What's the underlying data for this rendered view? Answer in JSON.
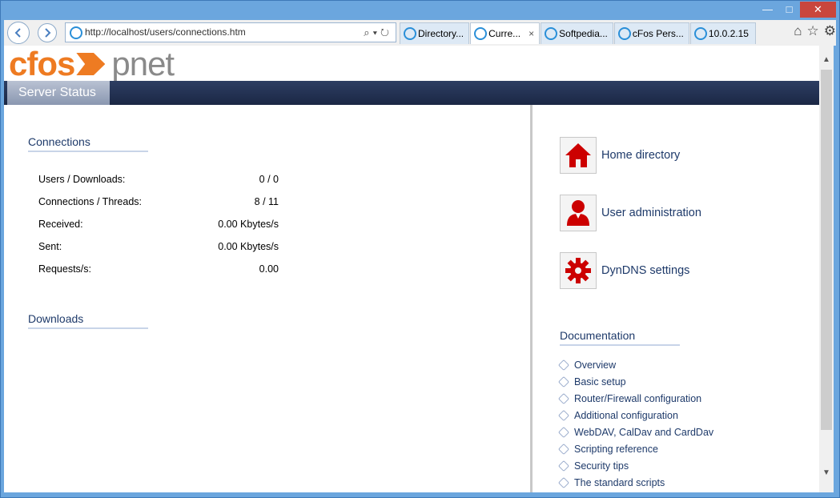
{
  "browser": {
    "url": "http://localhost/users/connections.htm",
    "tabs": [
      {
        "label": "Directory..."
      },
      {
        "label": "Curre...",
        "close": "×"
      },
      {
        "label": "Softpedia..."
      },
      {
        "label": "cFos Pers..."
      },
      {
        "label": "10.0.2.15"
      }
    ]
  },
  "logo": {
    "left": "cfos",
    "right": "pnet"
  },
  "header": {
    "tab": "Server Status"
  },
  "connections": {
    "title": "Connections",
    "rows": [
      {
        "label": "Users / Downloads:",
        "value": "0 / 0"
      },
      {
        "label": "Connections / Threads:",
        "value": "8 / 11"
      },
      {
        "label": "Received:",
        "value": "0.00 Kbytes/s"
      },
      {
        "label": "Sent:",
        "value": "0.00 Kbytes/s"
      },
      {
        "label": "Requests/s:",
        "value": "0.00"
      }
    ]
  },
  "downloads": {
    "title": "Downloads"
  },
  "links": {
    "home": "Home directory",
    "users": "User administration",
    "dyndns": "DynDNS settings"
  },
  "documentation": {
    "title": "Documentation",
    "items": [
      "Overview",
      "Basic setup",
      "Router/Firewall configuration",
      "Additional configuration",
      "WebDAV, CalDav and CardDav",
      "Scripting reference",
      "Security tips",
      "The standard scripts"
    ]
  },
  "colors": {
    "accent": "#cc0000",
    "brand": "#ee7b22",
    "header": "#1b2745"
  }
}
